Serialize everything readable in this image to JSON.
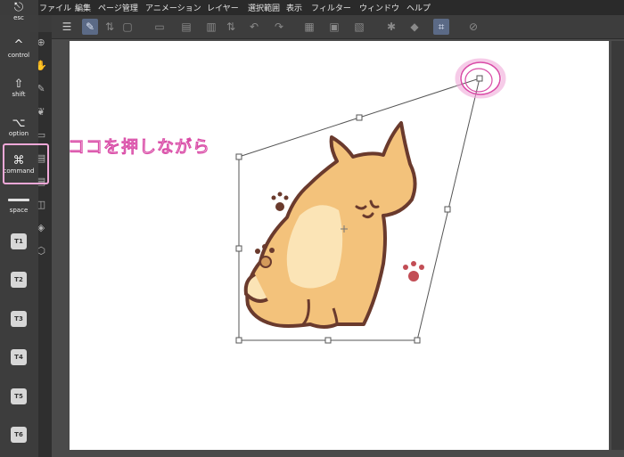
{
  "menu": {
    "items": [
      "ファイル",
      "編集",
      "ページ管理",
      "アニメーション",
      "レイヤー",
      "選択範囲",
      "表示",
      "フィルター",
      "ウィンドウ",
      "ヘルプ"
    ]
  },
  "keys": {
    "esc": {
      "glyph": "⎋",
      "label": "esc"
    },
    "control": {
      "glyph": "^",
      "label": "control"
    },
    "shift": {
      "glyph": "⇧",
      "label": "shift"
    },
    "option": {
      "glyph": "⌥",
      "label": "option"
    },
    "command": {
      "glyph": "⌘",
      "label": "command"
    },
    "space": {
      "glyph": "",
      "label": "space"
    },
    "t": [
      "T1",
      "T2",
      "T3",
      "T4",
      "T5",
      "T6"
    ]
  },
  "callout": {
    "text": "ココを押しながら"
  },
  "colors": {
    "highlight": "#f0a8d8",
    "callout_stroke": "#d94aa6",
    "menubar": "#2a2a2a",
    "canvas": "#ffffff"
  }
}
